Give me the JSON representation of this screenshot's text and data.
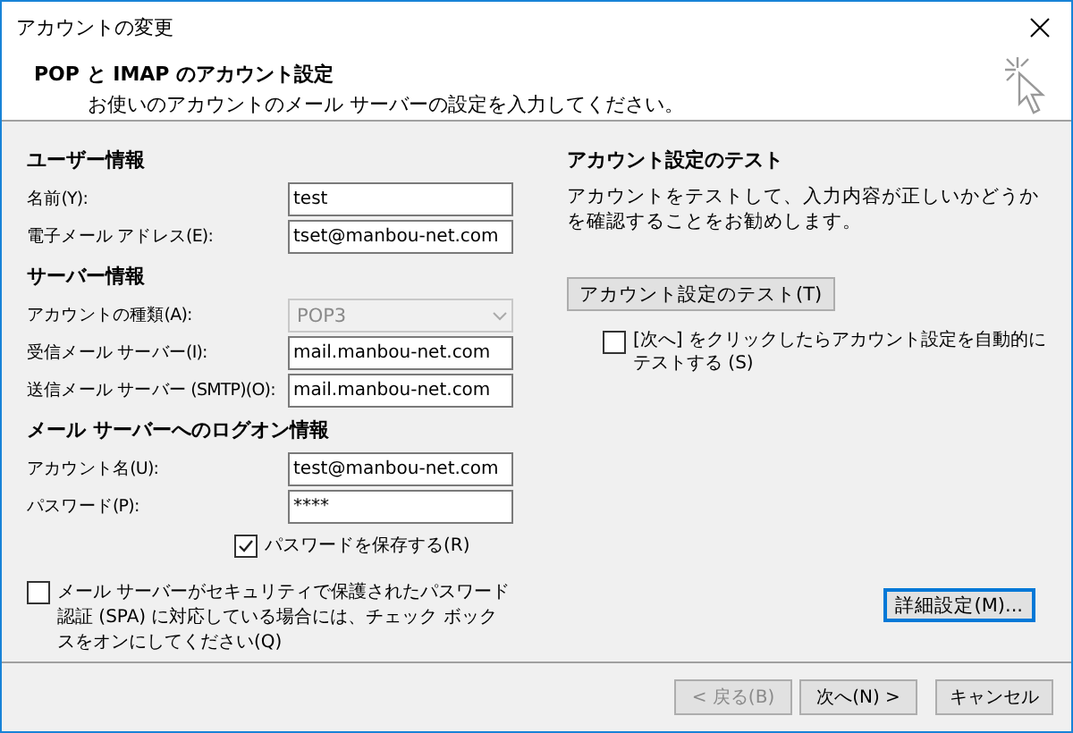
{
  "window": {
    "title": "アカウントの変更"
  },
  "header": {
    "title": "POP と IMAP のアカウント設定",
    "subtitle": "お使いのアカウントのメール サーバーの設定を入力してください。"
  },
  "sections": [
    {
      "title": "ユーザー情報",
      "fields": [
        {
          "kind": "text",
          "label": "名前(Y):",
          "value": "test"
        },
        {
          "kind": "text",
          "label": "電子メール アドレス(E):",
          "value": "tset@manbou-net.com"
        }
      ]
    },
    {
      "title": "サーバー情報",
      "fields": [
        {
          "kind": "select",
          "label": "アカウントの種類(A):",
          "value": "POP3",
          "disabled": true
        },
        {
          "kind": "text",
          "label": "受信メール サーバー(I):",
          "value": "mail.manbou-net.com"
        },
        {
          "kind": "text",
          "label": "送信メール サーバー (SMTP)(O):",
          "value": "mail.manbou-net.com"
        }
      ]
    },
    {
      "title": "メール サーバーへのログオン情報",
      "fields": [
        {
          "kind": "text",
          "label": "アカウント名(U):",
          "value": "test@manbou-net.com"
        },
        {
          "kind": "text",
          "label": "パスワード(P):",
          "value": "****"
        }
      ]
    }
  ],
  "remember_password": {
    "label": "パスワードを保存する(R)",
    "checked": true
  },
  "spa": {
    "label": "メール サーバーがセキュリティで保護されたパスワード認証 (SPA) に対応している場合には、チェック ボックスをオンにしてください(Q)",
    "checked": false
  },
  "test_panel": {
    "title": "アカウント設定のテスト",
    "description": "アカウントをテストして、入力内容が正しいかどうかを確認することをお勧めします。",
    "button": "アカウント設定のテスト(T)",
    "auto_test": {
      "label": "[次へ] をクリックしたらアカウント設定を自動的にテストする (S)",
      "checked": false
    }
  },
  "more_settings": "詳細設定(M)...",
  "buttons": [
    {
      "label": "< 戻る(B)",
      "disabled": true
    },
    {
      "label": "次へ(N) >",
      "disabled": false
    },
    {
      "label": "キャンセル",
      "disabled": false
    }
  ]
}
